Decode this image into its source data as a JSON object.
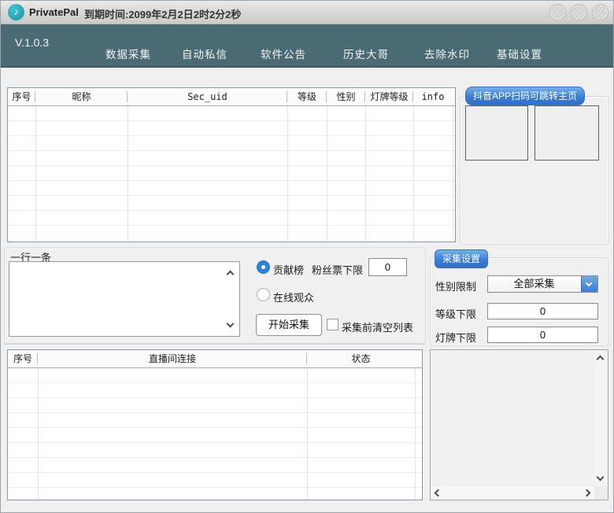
{
  "window": {
    "app_title": "PrivatePal",
    "expire_text": "到期时间:2099年2月2日2时2分2秒",
    "version": "V.1.0.3"
  },
  "nav": {
    "items": [
      {
        "label": "数据采集"
      },
      {
        "label": "自动私信"
      },
      {
        "label": "软件公告"
      },
      {
        "label": "历史大哥"
      },
      {
        "label": "去除水印"
      },
      {
        "label": "基础设置"
      }
    ]
  },
  "user_table": {
    "columns": [
      "序号",
      "昵称",
      "Sec_uid",
      "等级",
      "性别",
      "灯牌等级",
      "info"
    ],
    "rows": []
  },
  "qr_panel": {
    "label": "抖音APP扫码可跳转主页"
  },
  "capture_panel": {
    "lines_hint": "一行一条",
    "textarea_value": "",
    "radio_contribution_label": "贡献榜",
    "radio_online_label": "在线观众",
    "selected_radio": "贡献榜",
    "fans_ticket_label": "粉丝票下限",
    "fans_ticket_value": "0",
    "start_button_label": "开始采集",
    "clear_checkbox_label": "采集前清空列表",
    "clear_checkbox_checked": false
  },
  "collect_settings": {
    "group_label": "采集设置",
    "gender_label": "性别限制",
    "gender_value": "全部采集",
    "level_label": "等级下限",
    "level_value": "0",
    "lamp_label": "灯牌下限",
    "lamp_value": "0"
  },
  "room_table": {
    "columns": [
      "序号",
      "直播间连接",
      "状态"
    ],
    "rows": []
  },
  "colors": {
    "navbar": "#4a6a74",
    "accent_blue": "#3a7fd6",
    "logo_teal": "#1f93a6",
    "titlebar": "#d6d6d4"
  }
}
